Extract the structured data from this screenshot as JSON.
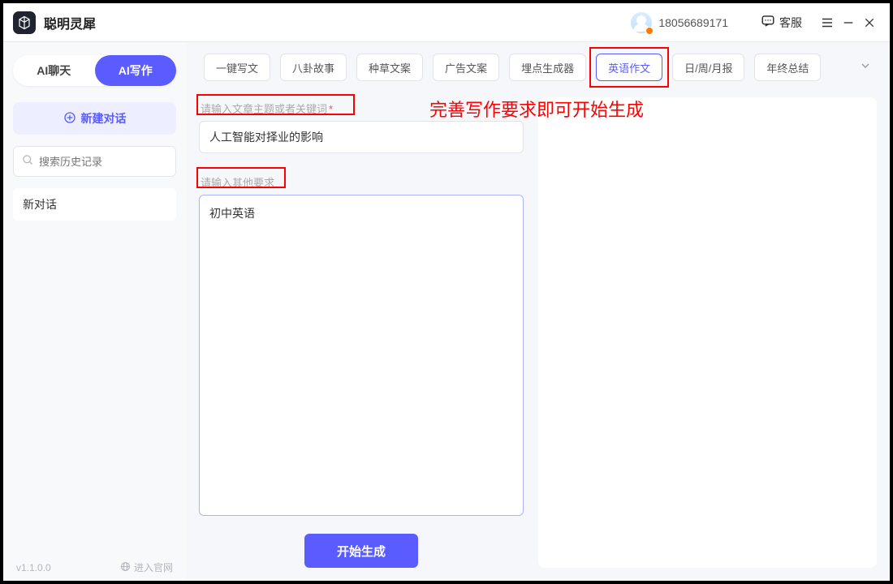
{
  "titlebar": {
    "app_name": "聪明灵犀",
    "phone": "18056689171",
    "support_label": "客服"
  },
  "sidebar": {
    "mode_chat": "AI聊天",
    "mode_write": "AI写作",
    "new_chat": "新建对话",
    "search_placeholder": "搜索历史记录",
    "history": [
      "新对话"
    ],
    "version": "v1.1.0.0",
    "enter_site": "进入官网"
  },
  "tabs": {
    "items": [
      "一键写文",
      "八卦故事",
      "种草文案",
      "广告文案",
      "埋点生成器",
      "英语作文",
      "日/周/月报",
      "年终总结"
    ],
    "active_index": 5
  },
  "form": {
    "topic_label": "请输入文章主题或者关键词",
    "topic_value": "人工智能对择业的影响",
    "other_label": "请输入其他要求",
    "other_value": "初中英语",
    "generate_label": "开始生成"
  },
  "annotation": {
    "hint": "完善写作要求即可开始生成"
  },
  "colors": {
    "primary": "#5a5cff",
    "highlight": "#ff0000"
  }
}
